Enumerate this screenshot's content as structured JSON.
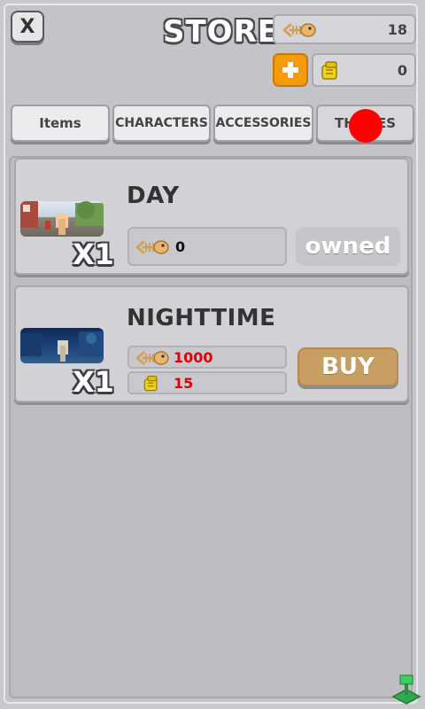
{
  "header": {
    "close_label": "X",
    "title": "STORE",
    "fish_balance": "18",
    "gold_balance": "0"
  },
  "tabs": [
    {
      "label": "Items"
    },
    {
      "label": "CHARACTERS"
    },
    {
      "label": "ACCESSORIES"
    },
    {
      "label": "THEMES"
    }
  ],
  "items": [
    {
      "name": "DAY",
      "multiplier": "X1",
      "fish_price": "0",
      "action_label": "owned"
    },
    {
      "name": "NIGHTTIME",
      "multiplier": "X1",
      "fish_price": "1000",
      "gold_price": "15",
      "action_label": "BUY"
    }
  ],
  "colors": {
    "accent_orange": "#f59b0b",
    "buy_button": "#c89f63",
    "price_red": "#e00000"
  }
}
